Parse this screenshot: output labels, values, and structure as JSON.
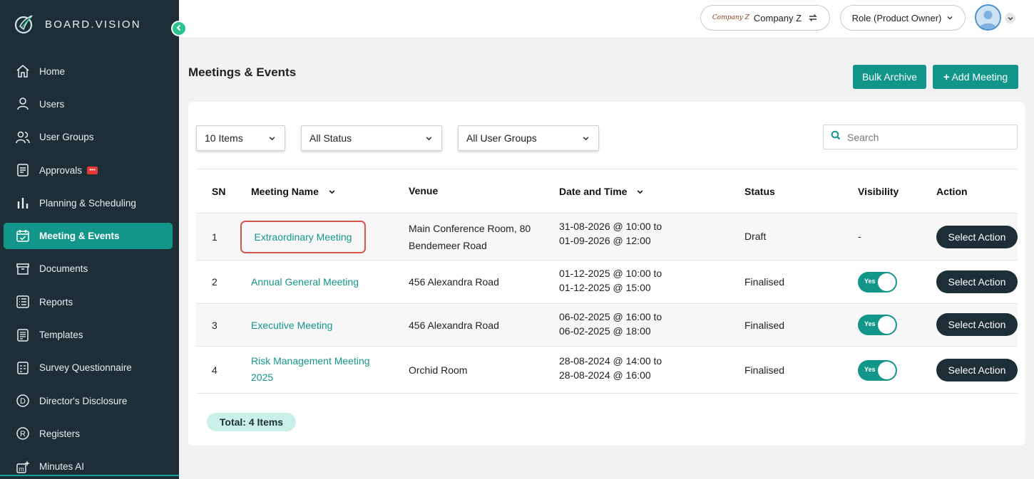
{
  "brand": {
    "name": "BOARD.VISION"
  },
  "sidebar": {
    "items": [
      {
        "label": "Home",
        "icon": "home-icon"
      },
      {
        "label": "Users",
        "icon": "user-icon"
      },
      {
        "label": "User Groups",
        "icon": "users-icon"
      },
      {
        "label": "Approvals",
        "icon": "approvals-icon",
        "badge": "•••"
      },
      {
        "label": "Planning & Scheduling",
        "icon": "bar-chart-icon"
      },
      {
        "label": "Meeting & Events",
        "icon": "calendar-icon",
        "active": true
      },
      {
        "label": "Documents",
        "icon": "archive-icon"
      },
      {
        "label": "Reports",
        "icon": "list-icon"
      },
      {
        "label": "Templates",
        "icon": "template-icon"
      },
      {
        "label": "Survey Questionnaire",
        "icon": "survey-icon"
      },
      {
        "label": "Director's Disclosure",
        "icon": "disclosure-d-icon",
        "glyph": "D"
      },
      {
        "label": "Registers",
        "icon": "registers-r-icon",
        "glyph": "R"
      },
      {
        "label": "Minutes AI",
        "icon": "minutes-ai-icon",
        "glyph": "m"
      }
    ]
  },
  "topbar": {
    "company_logo_text": "Company Z",
    "company_label": "Company Z",
    "role_label": "Role (Product Owner)"
  },
  "page": {
    "title": "Meetings & Events",
    "bulk_archive_label": "Bulk Archive",
    "add_meeting_label": "Add Meeting"
  },
  "filters": {
    "items_per_page": "10 Items",
    "status": "All Status",
    "user_groups": "All User Groups",
    "search_placeholder": "Search"
  },
  "table": {
    "headers": {
      "sn": "SN",
      "meeting_name": "Meeting Name",
      "venue": "Venue",
      "date_time": "Date and Time",
      "status": "Status",
      "visibility": "Visibility",
      "action": "Action"
    },
    "rows": [
      {
        "sn": "1",
        "name": "Extraordinary Meeting",
        "venue_line1": "Main Conference Room, 80",
        "venue_line2": "Bendemeer Road",
        "date_line1": "31-08-2026 @ 10:00 to",
        "date_line2": "01-09-2026 @ 12:00",
        "status": "Draft",
        "visibility": "-",
        "action": "Select Action"
      },
      {
        "sn": "2",
        "name": "Annual General Meeting",
        "venue_line1": "456 Alexandra Road",
        "date_line1": "01-12-2025 @ 10:00 to",
        "date_line2": "01-12-2025 @ 15:00",
        "status": "Finalised",
        "visibility": "Yes",
        "action": "Select Action"
      },
      {
        "sn": "3",
        "name": "Executive Meeting",
        "venue_line1": "456 Alexandra Road",
        "date_line1": "06-02-2025 @ 16:00 to",
        "date_line2": "06-02-2025 @ 18:00",
        "status": "Finalised",
        "visibility": "Yes",
        "action": "Select Action"
      },
      {
        "sn": "4",
        "name_line1": "Risk Management Meeting",
        "name_line2": "2025",
        "venue_line1": "Orchid Room",
        "date_line1": "28-08-2024 @ 14:00 to",
        "date_line2": "28-08-2024 @ 16:00",
        "status": "Finalised",
        "visibility": "Yes",
        "action": "Select Action"
      }
    ]
  },
  "footer": {
    "total_label": "Total: 4 Items"
  },
  "colors": {
    "sidebar_bg": "#1d2e36",
    "accent": "#13968a",
    "highlight_border": "#d9534f"
  }
}
